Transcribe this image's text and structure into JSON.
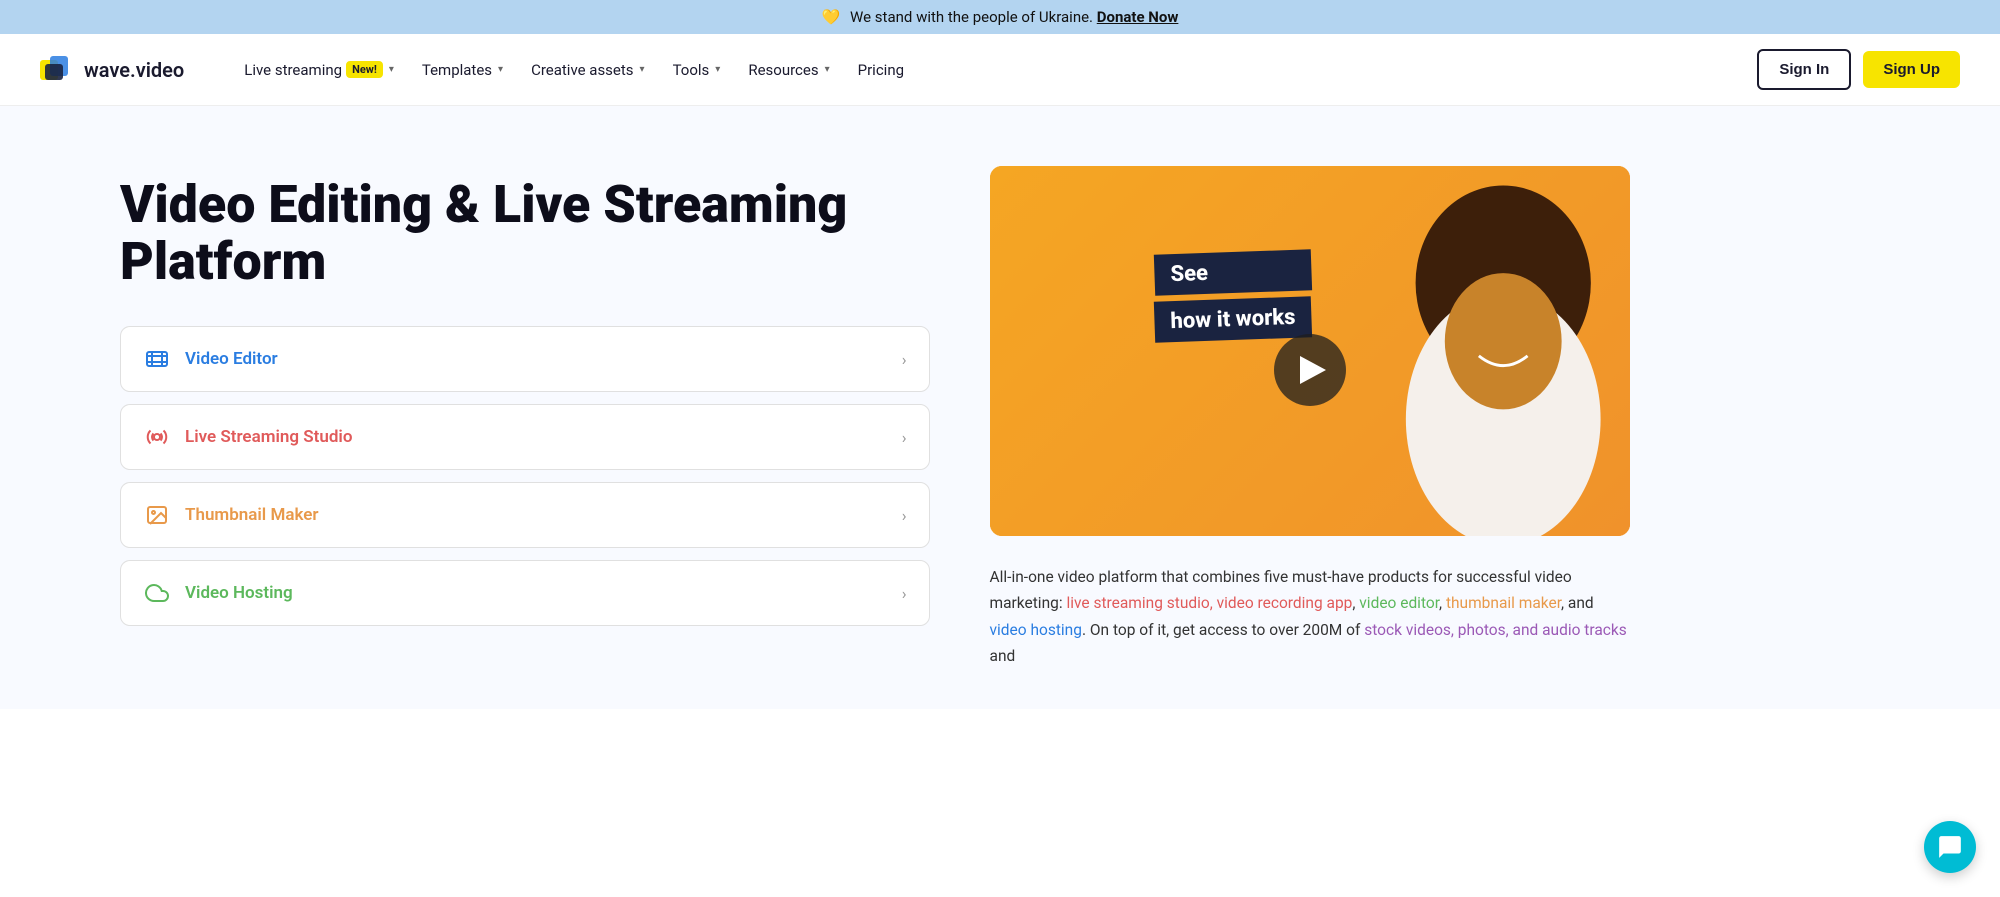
{
  "banner": {
    "heart": "💛",
    "text": "We stand with the people of Ukraine.",
    "link_text": "Donate Now",
    "link_url": "#"
  },
  "nav": {
    "logo_text": "wave.video",
    "items": [
      {
        "label": "Live streaming",
        "badge": "New!",
        "has_dropdown": true
      },
      {
        "label": "Templates",
        "has_dropdown": true
      },
      {
        "label": "Creative assets",
        "has_dropdown": true
      },
      {
        "label": "Tools",
        "has_dropdown": true
      },
      {
        "label": "Resources",
        "has_dropdown": true
      },
      {
        "label": "Pricing",
        "has_dropdown": false
      }
    ],
    "sign_in_label": "Sign In",
    "sign_up_label": "Sign Up"
  },
  "hero": {
    "title": "Video Editing & Live Streaming Platform",
    "features": [
      {
        "label": "Video Editor",
        "color": "#2a7de1",
        "icon_type": "film"
      },
      {
        "label": "Live Streaming Studio",
        "color": "#e05a5a",
        "icon_type": "broadcast"
      },
      {
        "label": "Thumbnail Maker",
        "color": "#e8994a",
        "icon_type": "image"
      },
      {
        "label": "Video Hosting",
        "color": "#5cb85c",
        "icon_type": "cloud"
      }
    ],
    "video": {
      "see_text": "See",
      "how_text": "how it works"
    },
    "description_parts": [
      {
        "text": "All-in-one video platform that combines five must-have products for successful video marketing: ",
        "type": "plain"
      },
      {
        "text": "live streaming studio, video recording app",
        "type": "red"
      },
      {
        "text": ", ",
        "type": "plain"
      },
      {
        "text": "video editor",
        "type": "green"
      },
      {
        "text": ", ",
        "type": "plain"
      },
      {
        "text": "thumbnail maker",
        "type": "orange"
      },
      {
        "text": ", and ",
        "type": "plain"
      },
      {
        "text": "video hosting",
        "type": "blue"
      },
      {
        "text": ". On top of it, get access to over 200M of ",
        "type": "plain"
      },
      {
        "text": "stock videos, photos, and audio tracks",
        "type": "purple"
      },
      {
        "text": " and",
        "type": "plain"
      }
    ]
  }
}
